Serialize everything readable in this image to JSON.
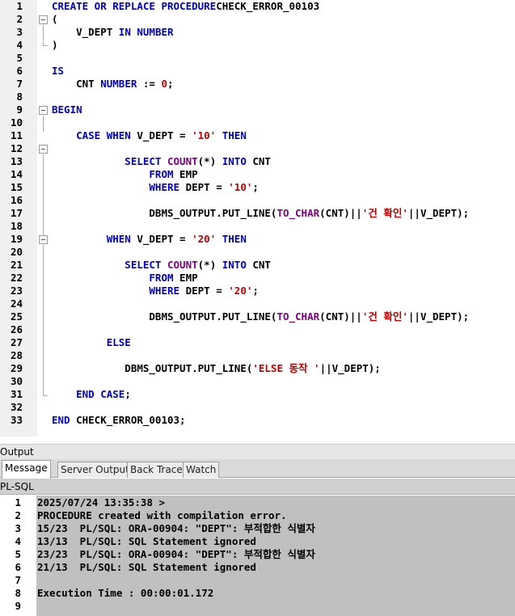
{
  "editor": {
    "lines": [
      {
        "n": "1",
        "segs": [
          [
            "kw",
            "CREATE OR REPLACE PROCEDURE"
          ],
          [
            "",
            "CHECK_ERROR_00103"
          ]
        ]
      },
      {
        "n": "2",
        "segs": [
          [
            "",
            "("
          ]
        ]
      },
      {
        "n": "3",
        "segs": [
          [
            "",
            "    V_DEPT "
          ],
          [
            "kw",
            "IN NUMBER"
          ]
        ]
      },
      {
        "n": "4",
        "segs": [
          [
            "",
            ")"
          ]
        ]
      },
      {
        "n": "5",
        "segs": []
      },
      {
        "n": "6",
        "segs": [
          [
            "kw",
            "IS"
          ]
        ]
      },
      {
        "n": "7",
        "segs": [
          [
            "",
            "    CNT "
          ],
          [
            "kw",
            "NUMBER"
          ],
          [
            "",
            " := "
          ],
          [
            "num",
            "0"
          ],
          [
            "",
            ";"
          ]
        ]
      },
      {
        "n": "8",
        "segs": []
      },
      {
        "n": "9",
        "segs": [
          [
            "kw",
            "BEGIN"
          ]
        ]
      },
      {
        "n": "10",
        "segs": []
      },
      {
        "n": "11",
        "segs": [
          [
            "kw",
            "    CASE WHEN"
          ],
          [
            "",
            " V_DEPT = "
          ],
          [
            "str",
            "'10'"
          ],
          [
            "kw",
            " THEN"
          ]
        ]
      },
      {
        "n": "12",
        "segs": []
      },
      {
        "n": "13",
        "segs": [
          [
            "kw",
            "            SELECT "
          ],
          [
            "fn",
            "COUNT"
          ],
          [
            "",
            "(*) "
          ],
          [
            "kw",
            "INTO"
          ],
          [
            "",
            " CNT"
          ]
        ]
      },
      {
        "n": "14",
        "segs": [
          [
            "kw",
            "                FROM"
          ],
          [
            "",
            " EMP"
          ]
        ]
      },
      {
        "n": "15",
        "segs": [
          [
            "kw",
            "                WHERE"
          ],
          [
            "",
            " DEPT = "
          ],
          [
            "str",
            "'10'"
          ],
          [
            "",
            ";"
          ]
        ]
      },
      {
        "n": "16",
        "segs": []
      },
      {
        "n": "17",
        "segs": [
          [
            "",
            "                DBMS_OUTPUT.PUT_LINE("
          ],
          [
            "fn",
            "TO_CHAR"
          ],
          [
            "",
            "(CNT)||"
          ],
          [
            "str",
            "'건 확인'"
          ],
          [
            "",
            "||V_DEPT);"
          ]
        ]
      },
      {
        "n": "18",
        "segs": []
      },
      {
        "n": "19",
        "segs": [
          [
            "kw",
            "         WHEN"
          ],
          [
            "",
            " V_DEPT = "
          ],
          [
            "str",
            "'20'"
          ],
          [
            "kw",
            " THEN"
          ]
        ]
      },
      {
        "n": "20",
        "segs": []
      },
      {
        "n": "21",
        "segs": [
          [
            "kw",
            "            SELECT "
          ],
          [
            "fn",
            "COUNT"
          ],
          [
            "",
            "(*) "
          ],
          [
            "kw",
            "INTO"
          ],
          [
            "",
            " CNT"
          ]
        ]
      },
      {
        "n": "22",
        "segs": [
          [
            "kw",
            "                FROM"
          ],
          [
            "",
            " EMP"
          ]
        ]
      },
      {
        "n": "23",
        "segs": [
          [
            "kw",
            "                WHERE"
          ],
          [
            "",
            " DEPT = "
          ],
          [
            "str",
            "'20'"
          ],
          [
            "",
            ";"
          ]
        ]
      },
      {
        "n": "24",
        "segs": []
      },
      {
        "n": "25",
        "segs": [
          [
            "",
            "                DBMS_OUTPUT.PUT_LINE("
          ],
          [
            "fn",
            "TO_CHAR"
          ],
          [
            "",
            "(CNT)||"
          ],
          [
            "str",
            "'건 확인'"
          ],
          [
            "",
            "||V_DEPT);"
          ]
        ]
      },
      {
        "n": "26",
        "segs": []
      },
      {
        "n": "27",
        "segs": [
          [
            "kw",
            "         ELSE"
          ]
        ]
      },
      {
        "n": "28",
        "segs": []
      },
      {
        "n": "29",
        "segs": [
          [
            "",
            "            DBMS_OUTPUT.PUT_LINE("
          ],
          [
            "str",
            "'ELSE 동작 '"
          ],
          [
            "",
            "||V_DEPT);"
          ]
        ]
      },
      {
        "n": "30",
        "segs": []
      },
      {
        "n": "31",
        "segs": [
          [
            "kw",
            "    END CASE"
          ],
          [
            "",
            ";"
          ]
        ]
      },
      {
        "n": "32",
        "segs": []
      },
      {
        "n": "33",
        "segs": [
          [
            "kw",
            "END"
          ],
          [
            "",
            " CHECK_ERROR_00103;"
          ]
        ]
      }
    ]
  },
  "output": {
    "title": "Output",
    "tabs": [
      "Message",
      "Server Output",
      "Back Trace",
      "Watch"
    ],
    "active_tab": "Message",
    "section": "PL-SQL",
    "lines": [
      {
        "n": "1",
        "text": "2025/07/24 13:35:38 >"
      },
      {
        "n": "2",
        "text": "PROCEDURE created with compilation error."
      },
      {
        "n": "3",
        "text": "15/23  PL/SQL: ORA-00904: \"DEPT\": 부적합한 식별자"
      },
      {
        "n": "4",
        "text": "13/13  PL/SQL: SQL Statement ignored"
      },
      {
        "n": "5",
        "text": "23/23  PL/SQL: ORA-00904: \"DEPT\": 부적합한 식별자"
      },
      {
        "n": "6",
        "text": "21/13  PL/SQL: SQL Statement ignored"
      },
      {
        "n": "7",
        "text": ""
      },
      {
        "n": "8",
        "text": "Execution Time : 00:00:01.172"
      },
      {
        "n": "9",
        "text": ""
      }
    ]
  }
}
